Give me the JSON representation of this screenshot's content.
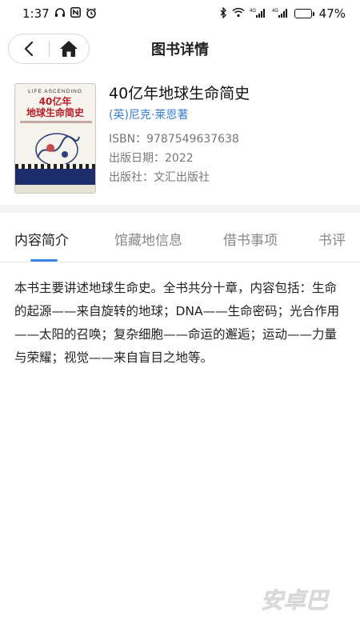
{
  "status_bar": {
    "time": "1:37",
    "battery_percent": "47%",
    "battery_level": 0.47,
    "network_labels": [
      "4G",
      "4G"
    ],
    "icons": [
      "headphones-icon",
      "nfc-icon",
      "alarm-icon",
      "bluetooth-icon",
      "wifi-icon",
      "signal-icon",
      "signal-icon",
      "battery-icon"
    ]
  },
  "header": {
    "title": "图书详情",
    "back_icon": "back-icon",
    "home_icon": "home-icon"
  },
  "book": {
    "title": "40亿年地球生命简史",
    "author": "(英)尼克·莱恩著",
    "isbn": "ISBN：9787549637638",
    "publish_date": "出版日期：2022",
    "publisher": "出版社：文汇出版社",
    "cover": {
      "english_title": "LIFE ASCENDING",
      "title_line1": "40亿年",
      "title_line2": "地球生命简史"
    }
  },
  "tabs": [
    {
      "label": "内容简介",
      "active": true
    },
    {
      "label": "馆藏地信息",
      "active": false
    },
    {
      "label": "借书事项",
      "active": false
    },
    {
      "label": "书评",
      "active": false
    }
  ],
  "content": {
    "summary": "本书主要讲述地球生命史。全书共分十章，内容包括：生命的起源——来自旋转的地球；DNA——生命密码；光合作用——太阳的召唤；复杂细胞——命运的邂逅；运动——力量与荣耀；视觉——来自盲目之地等。"
  },
  "watermark": {
    "text": "安卓巴"
  },
  "colors": {
    "accent": "#3a86e8",
    "author_link": "#3a7fd5",
    "cover_red": "#b81f2a",
    "cover_navy": "#1d2d6b"
  }
}
